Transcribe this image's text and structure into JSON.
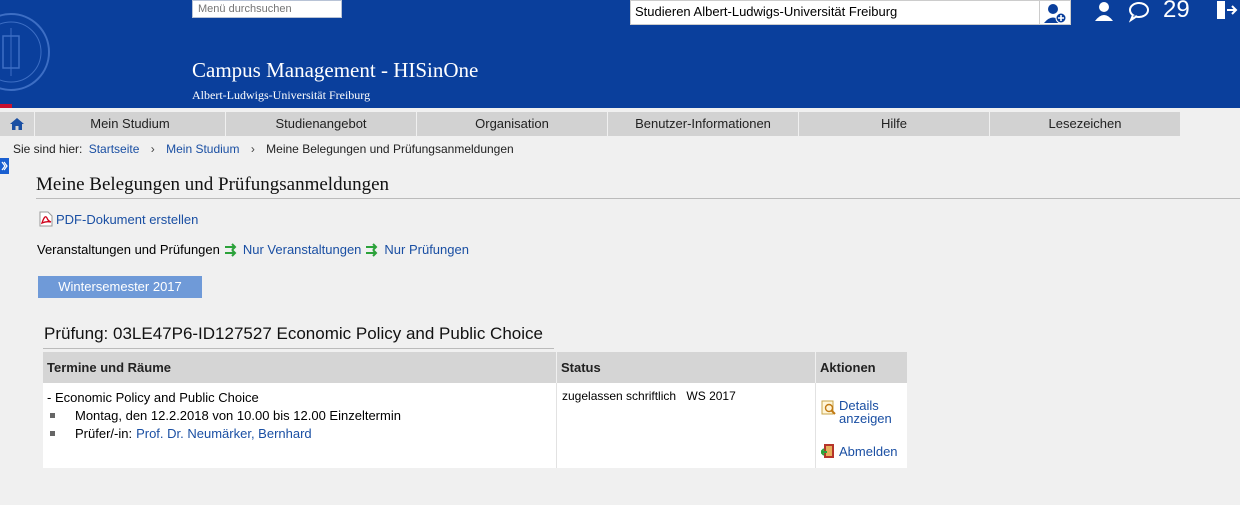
{
  "header": {
    "search_placeholder": "Menü durchsuchen",
    "app_title": "Campus Management - HISinOne",
    "app_subtitle": "Albert-Ludwigs-Universität Freiburg",
    "role_select": "Studieren Albert-Ludwigs-Universität Freiburg",
    "message_count": "29",
    "accent_color": "#0a3f9c"
  },
  "nav": {
    "items": [
      "Mein Studium",
      "Studienangebot",
      "Organisation",
      "Benutzer-Informationen",
      "Hilfe",
      "Lesezeichen"
    ]
  },
  "breadcrumb": {
    "prefix": "Sie sind hier:",
    "items": [
      "Startseite",
      "Mein Studium"
    ],
    "separator": "›",
    "current": "Meine Belegungen und Prüfungsanmeldungen"
  },
  "page": {
    "title": "Meine Belegungen und Prüfungsanmeldungen",
    "pdf_link": "PDF-Dokument erstellen",
    "filter_label": "Veranstaltungen und Prüfungen",
    "filter_lv": "Nur Veranstaltungen",
    "filter_pr": "Nur Prüfungen",
    "semester_tab": "Wintersemester 2017"
  },
  "exam": {
    "title": "Prüfung: 03LE47P6-ID127527 Economic Policy and Public Choice",
    "columns": [
      "Termine und Räume",
      "Status",
      "Aktionen"
    ],
    "event_name": "- Economic Policy and Public Choice",
    "date_line": "Montag, den 12.2.2018 von 10.00 bis 12.00 Einzeltermin",
    "examiner_label": "Prüfer/-in:",
    "examiner_name": "Prof. Dr. Neumärker, Bernhard",
    "status": "zugelassen schriftlich",
    "status_term": "WS 2017",
    "action_details_1": "Details",
    "action_details_2": "anzeigen",
    "action_abmelden": "Abmelden"
  }
}
